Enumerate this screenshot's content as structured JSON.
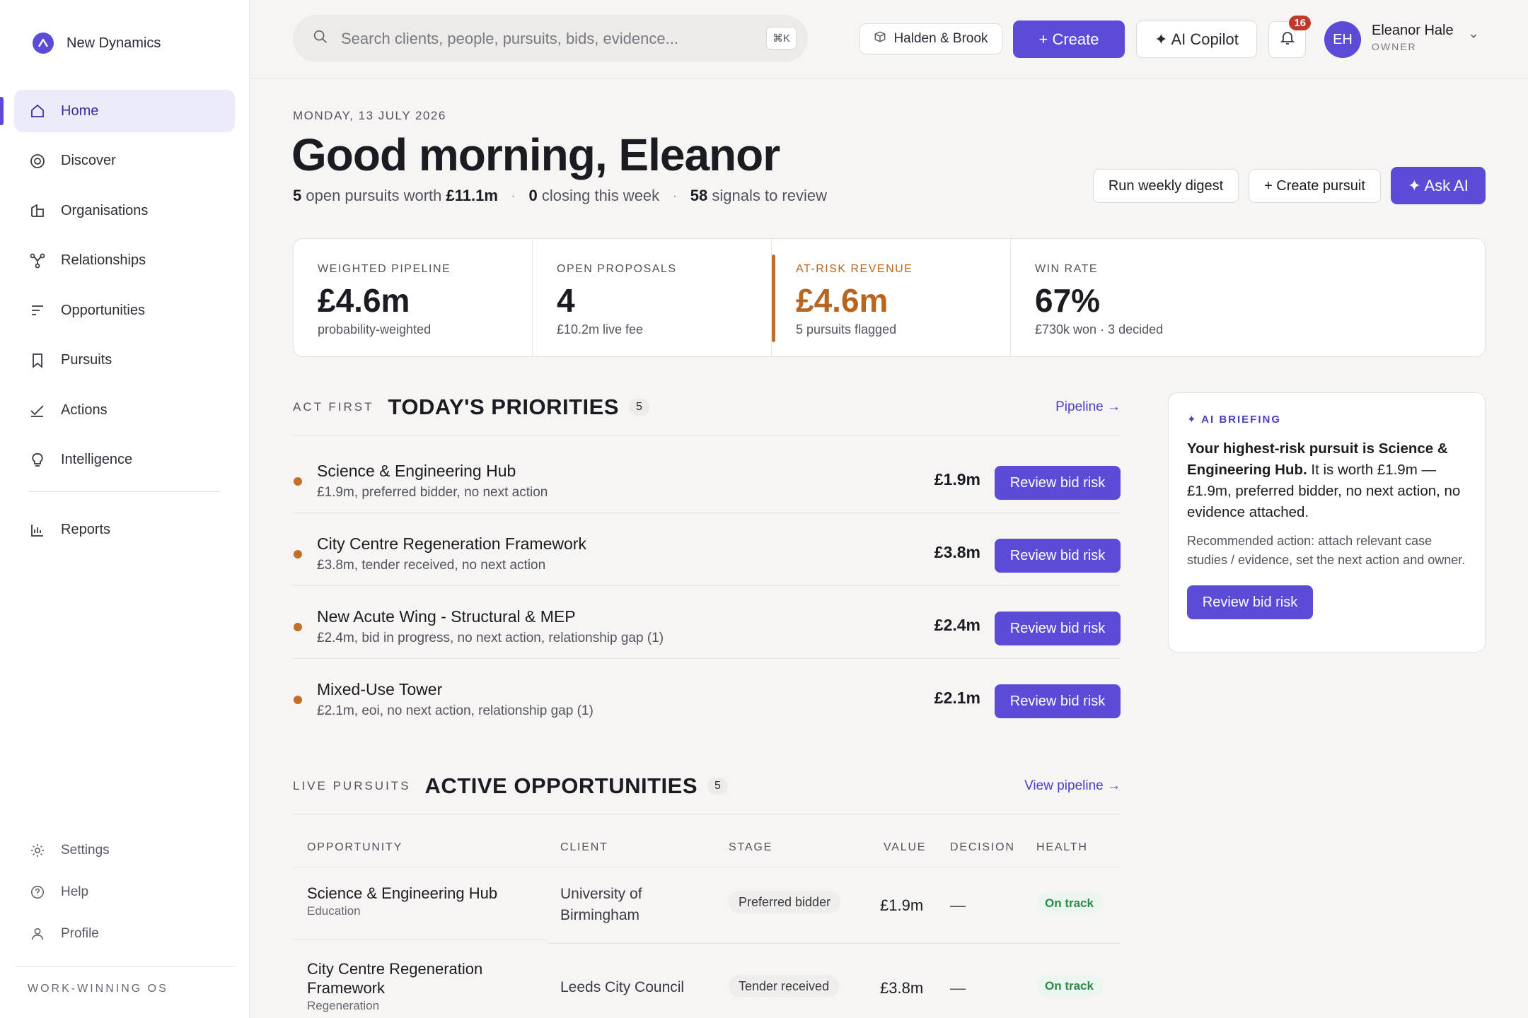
{
  "brand": {
    "name": "New Dynamics"
  },
  "nav": {
    "items": [
      {
        "label": "Home",
        "icon": "home-icon"
      },
      {
        "label": "Discover",
        "icon": "target-icon"
      },
      {
        "label": "Organisations",
        "icon": "building-icon"
      },
      {
        "label": "Relationships",
        "icon": "network-icon"
      },
      {
        "label": "Opportunities",
        "icon": "list-icon"
      },
      {
        "label": "Pursuits",
        "icon": "bookmark-icon"
      },
      {
        "label": "Actions",
        "icon": "check-icon"
      },
      {
        "label": "Intelligence",
        "icon": "lightbulb-icon"
      },
      {
        "label": "Reports",
        "icon": "bar-chart-icon"
      }
    ],
    "bottom": [
      {
        "label": "Settings",
        "icon": "gear-icon"
      },
      {
        "label": "Help",
        "icon": "help-icon"
      },
      {
        "label": "Profile",
        "icon": "user-icon"
      }
    ],
    "footer": "WORK-WINNING OS"
  },
  "topbar": {
    "search_placeholder": "Search clients, people, pursuits, bids, evidence...",
    "shortcut": "⌘K",
    "workspace": "Halden & Brook",
    "create_label": "+ Create",
    "copilot_label": "✦ AI Copilot",
    "notifications": "16",
    "user": {
      "initials": "EH",
      "name": "Eleanor Hale",
      "role": "OWNER"
    }
  },
  "header": {
    "date": "MONDAY, 13 JULY 2026",
    "greeting": "Good morning, Eleanor",
    "summary": {
      "open_count": "5",
      "open_text": "open pursuits worth",
      "open_value": "£11.1m",
      "closing_count": "0",
      "closing_text": "closing this week",
      "signals_count": "58",
      "signals_text": "signals to review"
    },
    "actions": {
      "digest": "Run weekly digest",
      "create_pursuit": "+ Create pursuit",
      "ask_ai": "✦ Ask AI"
    }
  },
  "kpis": [
    {
      "label": "WEIGHTED PIPELINE",
      "value": "£4.6m",
      "sub": "probability-weighted"
    },
    {
      "label": "OPEN PROPOSALS",
      "value": "4",
      "sub": "£10.2m live fee"
    },
    {
      "label": "AT-RISK REVENUE",
      "value": "£4.6m",
      "sub": "5 pursuits flagged"
    },
    {
      "label": "WIN RATE",
      "value": "67%",
      "sub": "£730k won · 3 decided"
    }
  ],
  "priorities": {
    "eyebrow": "ACT FIRST",
    "title": "TODAY'S PRIORITIES",
    "count": "5",
    "link": "Pipeline →",
    "items": [
      {
        "title": "Science & Engineering Hub",
        "sub": "£1.9m, preferred bidder, no next action",
        "value": "£1.9m",
        "button": "Review bid risk"
      },
      {
        "title": "City Centre Regeneration Framework",
        "sub": "£3.8m, tender received, no next action",
        "value": "£3.8m",
        "button": "Review bid risk"
      },
      {
        "title": "New Acute Wing - Structural & MEP",
        "sub": "£2.4m, bid in progress, no next action, relationship gap (1)",
        "value": "£2.4m",
        "button": "Review bid risk"
      },
      {
        "title": "Mixed-Use Tower",
        "sub": "£2.1m, eoi, no next action, relationship gap (1)",
        "value": "£2.1m",
        "button": "Review bid risk"
      }
    ]
  },
  "ai_briefing": {
    "eyebrow": "✦ AI BRIEFING",
    "headline_bold": "Your highest-risk pursuit is Science & Engineering Hub.",
    "headline_rest": " It is worth £1.9m — £1.9m, preferred bidder, no next action, no evidence attached.",
    "recommendation": "Recommended action: attach relevant case studies / evidence, set the next action and owner.",
    "button": "Review bid risk"
  },
  "opportunities": {
    "eyebrow": "LIVE PURSUITS",
    "title": "ACTIVE OPPORTUNITIES",
    "count": "5",
    "link": "View pipeline →",
    "columns": [
      "OPPORTUNITY",
      "CLIENT",
      "STAGE",
      "VALUE",
      "DECISION",
      "HEALTH"
    ],
    "rows": [
      {
        "name": "Science & Engineering Hub",
        "sector": "Education",
        "client": "University of Birmingham",
        "stage": "Preferred bidder",
        "value": "£1.9m",
        "decision": "—",
        "health": "On track"
      },
      {
        "name": "City Centre Regeneration Framework",
        "sector": "Regeneration",
        "client": "Leeds City Council",
        "stage": "Tender received",
        "value": "£3.8m",
        "decision": "—",
        "health": "On track"
      }
    ]
  },
  "colors": {
    "accent": "#5b4bd6",
    "risk": "#c0702a",
    "positive": "#2c8a4a"
  }
}
